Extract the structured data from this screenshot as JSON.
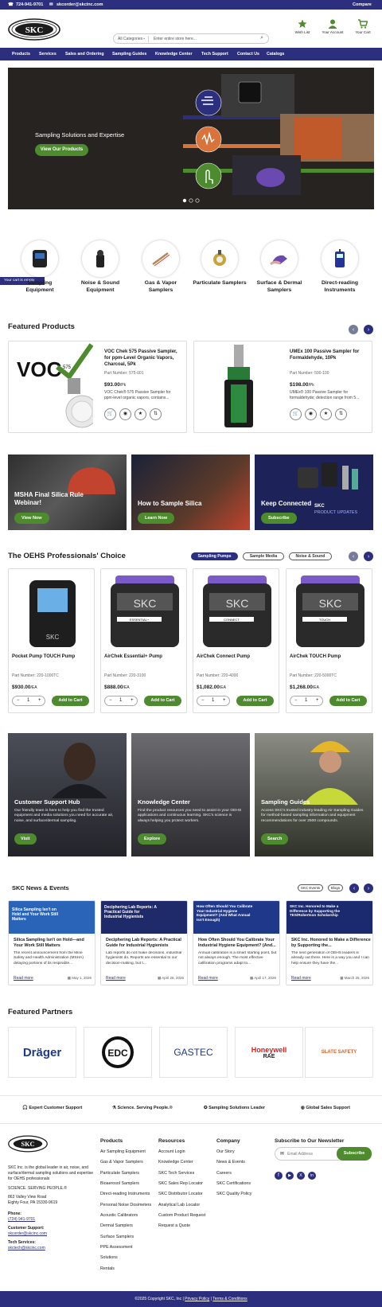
{
  "topbar": {
    "phone": "724-941-9701",
    "email": "skcorder@skcinc.com",
    "compare": "Compare"
  },
  "header": {
    "logo_text": "SKC",
    "search_category": "All Categories",
    "search_placeholder": "Enter entire store here...",
    "actions": {
      "wishlist": "Wish List",
      "account": "Your Account",
      "cart": "Your Cart"
    }
  },
  "nav": [
    "Products",
    "Services",
    "Sales and Ordering",
    "Sampling Guides",
    "Knowledge Center",
    "Tech Support",
    "Contact Us",
    "Catalogs"
  ],
  "hero": {
    "title": "Sampling Solutions and Expertise",
    "button": "View Our Products"
  },
  "cart_tab": "Your cart is empty",
  "categories": [
    {
      "label1": "Sampling",
      "label2": "Equipment"
    },
    {
      "label1": "Noise & Sound",
      "label2": "Equipment"
    },
    {
      "label1": "Gas & Vapor",
      "label2": "Samplers"
    },
    {
      "label1": "Particulate Samplers",
      "label2": ""
    },
    {
      "label1": "Surface & Dermal",
      "label2": "Samplers"
    },
    {
      "label1": "Direct-reading",
      "label2": "Instruments"
    }
  ],
  "featured": {
    "heading": "Featured Products",
    "items": [
      {
        "name1": "VOC Chek 575 Passive Sampler,",
        "name2": "for ppm-Level Organic Vapors,",
        "name3": "Charcoal, 5Pk",
        "part": "Part Number:  575-001",
        "price": "$93.00",
        "unit": "/Pk",
        "desc1": "VOC Chek® 575 Passive Sampler for",
        "desc2": "ppm-level organic vapors, contains..."
      },
      {
        "name1": "UMEx 100 Passive Sampler for",
        "name2": "Formaldehyde, 10Pk",
        "name3": "",
        "part": "Part Number:  500-100",
        "price": "$198.00",
        "unit": "/Pk",
        "desc1": "UMEx® 100 Passive Sampler for",
        "desc2": "formaldehyde; detection range from 5..."
      }
    ]
  },
  "promos": [
    {
      "title1": "MSHA Final Silica Rule",
      "title2": "Webinar!",
      "button": "View Now"
    },
    {
      "title1": "How to Sample Silica",
      "title2": "",
      "button": "Learn Now"
    },
    {
      "title1": "Keep Connected",
      "title2": "",
      "button": "Subscribe",
      "brand": "SKC",
      "tag": "PRODUCT UPDATES"
    }
  ],
  "choice": {
    "heading": "The OEHS Professionals' Choice",
    "tabs": [
      "Sampling Pumps",
      "Sample Media",
      "Noise & Sound"
    ],
    "products": [
      {
        "name": "Pocket Pump TOUCH Pump",
        "part": "Part Number:  220-1000TC",
        "price": "$930.00",
        "unit": "/EA",
        "qty": "1",
        "button": "Add to Cart",
        "model": ""
      },
      {
        "name": "AirChek Essential+ Pump",
        "part": "Part Number:  220-3100",
        "price": "$888.00",
        "unit": "/EA",
        "qty": "1",
        "button": "Add to Cart",
        "model": "ESSENTIAL+"
      },
      {
        "name": "AirChek Connect Pump",
        "part": "Part Number:  220-4000",
        "price": "$1,082.00",
        "unit": "/EA",
        "qty": "1",
        "button": "Add to Cart",
        "model": "CONNECT"
      },
      {
        "name": "AirChek TOUCH Pump",
        "part": "Part Number:  220-5000TC",
        "price": "$1,268.00",
        "unit": "/EA",
        "qty": "1",
        "button": "Add to Cart",
        "model": "TOUCH"
      }
    ]
  },
  "hubs": [
    {
      "title": "Customer Support Hub",
      "desc": "Our friendly team is here to help you find the trusted equipment and media solutions you need for accurate air, noise, and surface/dermal sampling.",
      "button": "Visit"
    },
    {
      "title": "Knowledge Center",
      "desc": "Find the product resources you need to assist in your OEHS applications and continuous learning. SKC's science is always helping you protect workers.",
      "button": "Explore"
    },
    {
      "title": "Sampling Guides",
      "desc": "Access SKC's trusted industry-leading Air Sampling Guides for method-based sampling information and equipment recommendations for over 2500 compounds.",
      "button": "Search"
    }
  ],
  "news": {
    "heading": "SKC News & Events",
    "filters": [
      "SKC Events",
      "Blogs"
    ],
    "items": [
      {
        "img_text": "Silica Sampling Isn't on Hold and Your Work Still Matters",
        "title": "Silica Sampling Isn't on Hold—and Your Work Still Matters",
        "desc": "The recent announcement from the Mine Safety and Health Administration (MSHA) delaying portions of its respirable...",
        "read": "Read more",
        "date": "May 1, 2026"
      },
      {
        "img_text": "Deciphering Lab Reports: A Practical Guide for Industrial Hygienists",
        "title": "Deciphering Lab Reports: A Practical Guide for Industrial Hygienists",
        "desc": "Lab reports do not make decisions, industrial hygienists do. Reports are essential to our decision-making, but t...",
        "read": "Read more",
        "date": "April 28, 2026"
      },
      {
        "img_text": "How Often Should You Calibrate Your Industrial Hygiene Equipment? (And What Annual Isn't Enough)",
        "title": "How Often Should You Calibrate Your Industrial Hygiene Equipment? (And...",
        "desc": "Annual calibration is a smart starting point, but not always enough. The most effective calibration programs adapt to...",
        "read": "Read more",
        "date": "April 17, 2026"
      },
      {
        "img_text": "SKC Inc. Honored to Make a Difference by Supporting the TES/Robertson Scholarship",
        "title": "SKC Inc. Honored to Make a Difference by Supporting the...",
        "desc": "The next generation of OEHS leaders is already out there. Here is a way you and I can help ensure they have the...",
        "read": "Read more",
        "date": "March 25, 2026"
      }
    ]
  },
  "partners": {
    "heading": "Featured Partners",
    "names": [
      "Dräger",
      "EDC",
      "GASTEC",
      "Honeywell",
      "SLATE SAFETY"
    ],
    "honeywell_sub": "RAE"
  },
  "trust": [
    "Expert Customer Support",
    "Science. Serving People.®",
    "Sampling Solutions Leader",
    "Global Sales Support"
  ],
  "footer": {
    "about": "SKC Inc. is the global leader in air, noise, and surface/dermal sampling solutions and expertise for OEHS professionals",
    "tagline": "SCIENCE. SERVING PEOPLE.®",
    "addr1": "863 Valley View Road",
    "addr2": "Eighty Four, PA 15330-9619",
    "phone_label": "Phone:",
    "phone": "(724) 941-9701",
    "support_label": "Customer Support:",
    "support_email": "skcorder@skcinc.com",
    "tech_label": "Tech Services:",
    "tech_email": "skctech@skcinc.com",
    "products_h": "Products",
    "products": [
      "Air Sampling Equipment",
      "Gas & Vapor Samplers",
      "Particulate Samplers",
      "Bioaerosol Samplers",
      "Direct-reading Instruments",
      "Personal Noise Dosimeters",
      "Acoustic Calibrators",
      "Dermal Samplers",
      "Surface Samplers",
      "PPE Assessment",
      "Solutions",
      "Rentals"
    ],
    "resources_h": "Resources",
    "resources": [
      "Account Login",
      "Knowledge Center",
      "SKC Tech Services",
      "SKC Sales Rep Locator",
      "SKC Distributor Locator",
      "Analytical Lab Locator",
      "Custom Product Request",
      "Request a Quote"
    ],
    "company_h": "Company",
    "company": [
      "Our Story",
      "News & Events",
      "Careers",
      "SKC Certifications",
      "SKC Quality Policy"
    ],
    "newsletter_h": "Subscribe to Our Newsletter",
    "email_placeholder": "Email Address",
    "subscribe": "Subscribe"
  },
  "copyright": "©2025 Copyright SKC, Inc |",
  "privacy": "Privacy Policy",
  "terms": "Terms & Conditions",
  "colors": {
    "brand": "#2b2f7e",
    "accent": "#4d8b2e"
  }
}
